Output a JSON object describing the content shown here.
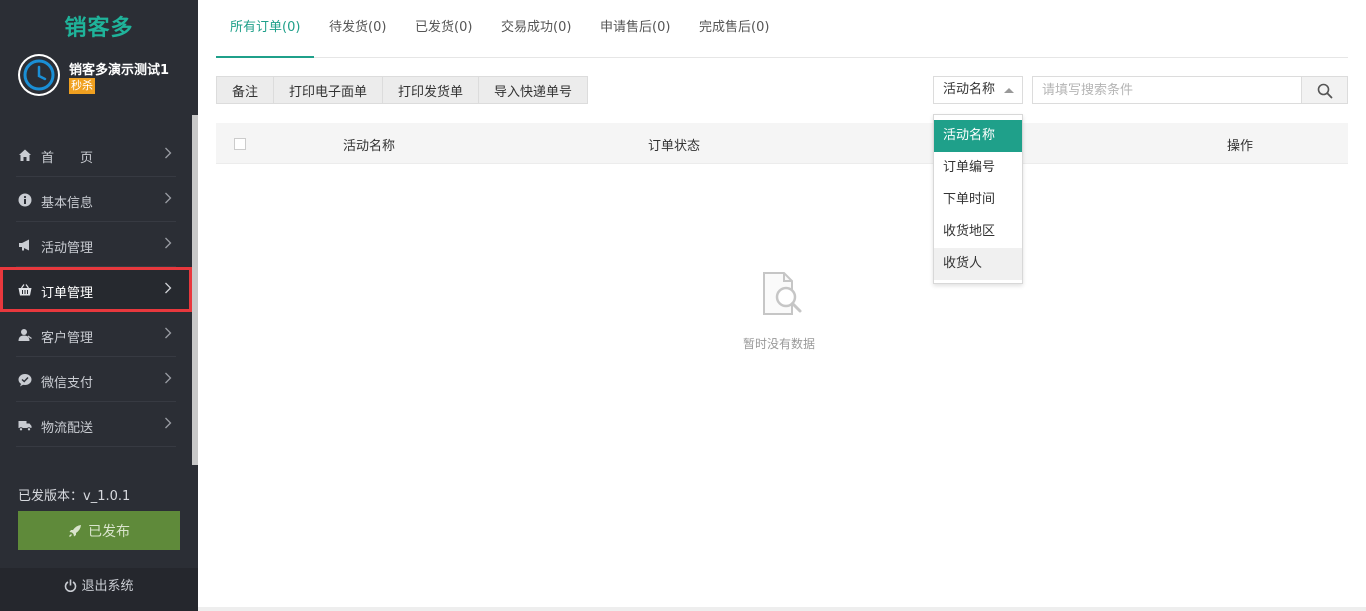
{
  "sidebar": {
    "logo": "销客多",
    "user": {
      "name": "销客多演示测试1",
      "badge": "秒杀"
    },
    "items": [
      {
        "label": "首　　页",
        "icon": "home-icon"
      },
      {
        "label": "基本信息",
        "icon": "info-icon"
      },
      {
        "label": "活动管理",
        "icon": "megaphone-icon"
      },
      {
        "label": "订单管理",
        "icon": "basket-icon"
      },
      {
        "label": "客户管理",
        "icon": "user-icon"
      },
      {
        "label": "微信支付",
        "icon": "wechat-icon"
      },
      {
        "label": "物流配送",
        "icon": "truck-icon"
      }
    ],
    "version": "已发版本：v_1.0.1",
    "publish_label": "已发布",
    "logout_label": "退出系统"
  },
  "tabs": [
    {
      "label": "所有订单(0)"
    },
    {
      "label": "待发货(0)"
    },
    {
      "label": "已发货(0)"
    },
    {
      "label": "交易成功(0)"
    },
    {
      "label": "申请售后(0)"
    },
    {
      "label": "完成售后(0)"
    }
  ],
  "toolbar": {
    "buttons": [
      {
        "label": "备注"
      },
      {
        "label": "打印电子面单"
      },
      {
        "label": "打印发货单"
      },
      {
        "label": "导入快递单号"
      }
    ]
  },
  "search": {
    "field_selected": "活动名称",
    "placeholder": "请填写搜索条件",
    "options": [
      "活动名称",
      "订单编号",
      "下单时间",
      "收货地区",
      "收货人"
    ]
  },
  "table": {
    "columns": [
      "活动名称",
      "订单状态",
      "操作"
    ],
    "empty_text": "暂时没有数据"
  },
  "colors": {
    "accent": "#1fa08a",
    "sidebar_bg": "#2b2e35",
    "highlight_border": "#e8383d",
    "publish_bg": "#5f8a3a",
    "badge": "#f0a020"
  }
}
